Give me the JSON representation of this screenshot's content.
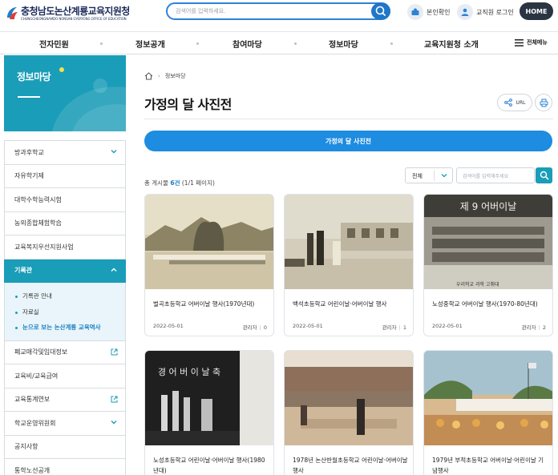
{
  "header": {
    "logo_title": "충청남도논산계룡교육지원청",
    "logo_sub": "CHUNGCHEONGNAMDO NONSAN GYERYONG OFFICE OF EDUCATION",
    "search_placeholder": "검색어를 입력하세요.",
    "identity_label": "본인확인",
    "staff_login_label": "교직원 로그인",
    "home_label": "HOME"
  },
  "gnb": {
    "items": [
      "전자민원",
      "정보공개",
      "참여마당",
      "정보마당",
      "교육지원청 소개"
    ],
    "all_menu_label": "전체메뉴"
  },
  "sidebar": {
    "title": "정보마당",
    "items": [
      {
        "label": "방과후학교",
        "type": "chevron"
      },
      {
        "label": "자유학기제",
        "type": "none"
      },
      {
        "label": "대학수학능력시험",
        "type": "none"
      },
      {
        "label": "농외종합체험학습",
        "type": "none"
      },
      {
        "label": "교육복지우선지원사업",
        "type": "none"
      }
    ],
    "active_item": {
      "label": "기록관"
    },
    "sub_items": [
      {
        "label": "기록관 안내",
        "current": false
      },
      {
        "label": "자료실",
        "current": false
      },
      {
        "label": "눈으로 보는 논산계룡 교육역사",
        "current": true
      }
    ],
    "items_after": [
      {
        "label": "폐교매각및임대정보",
        "type": "external"
      },
      {
        "label": "교육비/교육급여",
        "type": "none"
      },
      {
        "label": "교육통계연보",
        "type": "external"
      },
      {
        "label": "학교운영위원회",
        "type": "chevron"
      },
      {
        "label": "공지사항",
        "type": "none"
      },
      {
        "label": "통학노선공개",
        "type": "none"
      }
    ]
  },
  "main": {
    "breadcrumb": [
      "정보마당"
    ],
    "page_title": "가정의 달 사진전",
    "share_label": "URL",
    "tab_label": "가정의 달 사진전",
    "count_prefix": "총 게시물 ",
    "count_value": "6건",
    "count_pages": " (1/1 페이지)",
    "select_value": "전체",
    "search_placeholder": "검색어를 입력해주세요",
    "cards": [
      {
        "title": "벌곡초등학교 어버이날 행사(1970년대)",
        "date": "2022-05-01",
        "writer_label": "관리자",
        "views": "0",
        "photo": "outdoor-field-mountains",
        "caption": ""
      },
      {
        "title": "백석초등학교 어린이날·어버이날 행사",
        "date": "2022-05-01",
        "writer_label": "관리자",
        "views": "1",
        "photo": "ceremony-school-yard",
        "caption": ""
      },
      {
        "title": "노성중학교 어버이날 행사(1970-80년대)",
        "date": "2022-05-01",
        "writer_label": "관리자",
        "views": "2",
        "photo": "stage-banner-students",
        "caption": "우리학교 과학 고취대",
        "banner": "제 9 어버이날"
      },
      {
        "title": "노성초등학교 어린이날·어버이날 행사(1980년대)",
        "date": "",
        "writer_label": "",
        "views": "",
        "photo": "stage-black-white",
        "caption": "",
        "banner": "경 어 버 이 날 축"
      },
      {
        "title": "1978년 논산반월초등학교 어린이날·어버이날 행사",
        "date": "",
        "writer_label": "",
        "views": "",
        "photo": "playground-crowd",
        "caption": ""
      },
      {
        "title": "1979년 부적초등학교 어버이날·어린이날 기념행사",
        "date": "",
        "writer_label": "",
        "views": "",
        "photo": "tent-crowd-flag",
        "caption": ""
      }
    ]
  },
  "colors": {
    "primary_blue": "#1e8ce0",
    "teal": "#1a9db8",
    "home_dark": "#2b3442",
    "yellow_dot": "#f4e04d"
  }
}
